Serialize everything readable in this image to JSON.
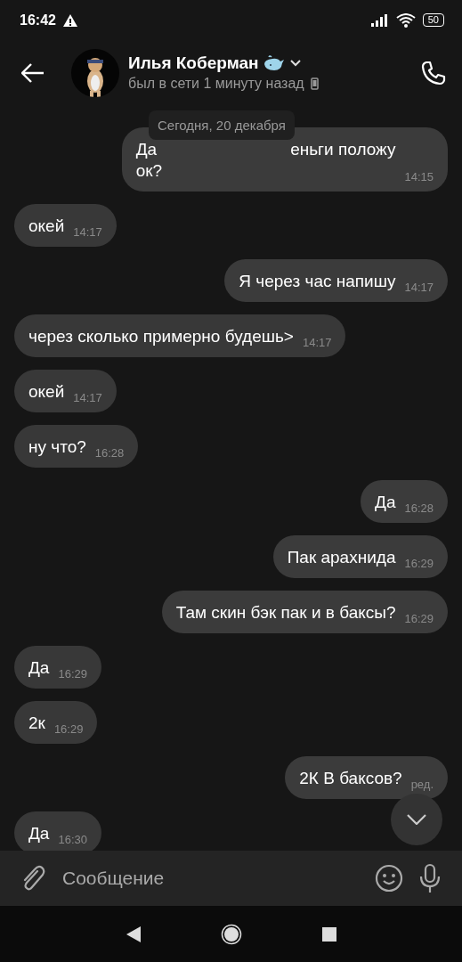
{
  "status_bar": {
    "time": "16:42",
    "battery": "50"
  },
  "header": {
    "name": "Илья Коберман",
    "status": "был в сети 1 минуту назад"
  },
  "date_badge": "Сегодня, 20 декабря",
  "messages": [
    {
      "kind": "out",
      "lines": [
        [
          "Да",
          "еньги положу"
        ],
        [
          "ок?"
        ]
      ],
      "time": "14:15"
    },
    {
      "kind": "in",
      "lines": [
        [
          "окей"
        ]
      ],
      "time": "14:17"
    },
    {
      "kind": "out",
      "lines": [
        [
          "Я через час напишу"
        ]
      ],
      "time": "14:17"
    },
    {
      "kind": "in",
      "lines": [
        [
          "через сколько примерно будешь>"
        ]
      ],
      "time": "14:17"
    },
    {
      "kind": "in",
      "lines": [
        [
          "окей"
        ]
      ],
      "time": "14:17"
    },
    {
      "kind": "in",
      "lines": [
        [
          "ну что?"
        ]
      ],
      "time": "16:28"
    },
    {
      "kind": "out",
      "lines": [
        [
          "Да"
        ]
      ],
      "time": "16:28"
    },
    {
      "kind": "out",
      "lines": [
        [
          "Пак арахнида"
        ]
      ],
      "time": "16:29"
    },
    {
      "kind": "out",
      "lines": [
        [
          "Там скин бэк пак и в баксы?"
        ]
      ],
      "time": "16:29"
    },
    {
      "kind": "in",
      "lines": [
        [
          "Да"
        ]
      ],
      "time": "16:29"
    },
    {
      "kind": "in",
      "lines": [
        [
          "2к"
        ]
      ],
      "time": "16:29"
    },
    {
      "kind": "out",
      "lines": [
        [
          "2К В баксов?"
        ]
      ],
      "time": "ред."
    },
    {
      "kind": "in",
      "lines": [
        [
          "Да"
        ]
      ],
      "time": "16:30"
    }
  ],
  "composer": {
    "placeholder": "Сообщение"
  }
}
